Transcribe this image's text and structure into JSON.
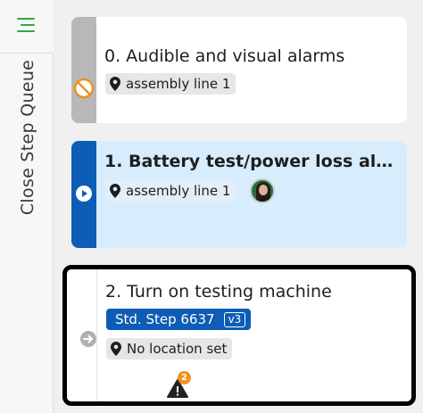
{
  "sidebar": {
    "menu_icon": "menu-icon",
    "toggle_label": "Close Step Queue"
  },
  "steps": [
    {
      "title": "0. Audible and visual alarms",
      "status_icon": "skipped-icon",
      "location": "assembly line 1",
      "strip_color": "#b8b8b8"
    },
    {
      "title": "1. Battery test/power loss al...",
      "status_icon": "play-icon",
      "location": "assembly line 1",
      "strip_color": "#0d5cb5",
      "background": "#d7edfd",
      "assignee_avatar": "user-avatar"
    },
    {
      "title": "2. Turn on testing machine",
      "status_icon": "arrow-right-icon",
      "std_step_label": "Std. Step 6637",
      "std_step_version": "v3",
      "location": "No location set",
      "warning_count": "2",
      "accent_color": "#0d5cb5",
      "warning_color": "#f0901e"
    }
  ]
}
